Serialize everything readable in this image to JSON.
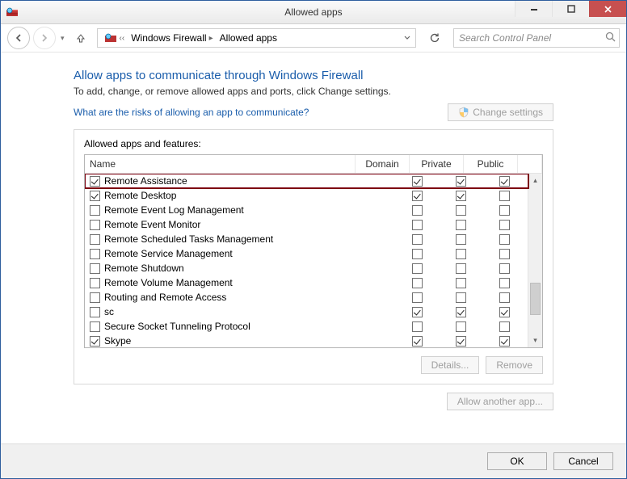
{
  "window": {
    "title": "Allowed apps"
  },
  "nav": {
    "breadcrumb": {
      "part1": "Windows Firewall",
      "part2": "Allowed apps"
    },
    "search_placeholder": "Search Control Panel"
  },
  "page": {
    "heading": "Allow apps to communicate through Windows Firewall",
    "subheading": "To add, change, or remove allowed apps and ports, click Change settings.",
    "risk_link": "What are the risks of allowing an app to communicate?",
    "change_settings": "Change settings",
    "group_label": "Allowed apps and features:",
    "columns": {
      "name": "Name",
      "domain": "Domain",
      "private": "Private",
      "public": "Public"
    },
    "details": "Details...",
    "remove": "Remove",
    "allow_another": "Allow another app..."
  },
  "rows": [
    {
      "name": "Remote Assistance",
      "enabled": true,
      "domain": true,
      "private": true,
      "public": true,
      "highlight": true
    },
    {
      "name": "Remote Desktop",
      "enabled": true,
      "domain": true,
      "private": true,
      "public": false
    },
    {
      "name": "Remote Event Log Management",
      "enabled": false,
      "domain": false,
      "private": false,
      "public": false
    },
    {
      "name": "Remote Event Monitor",
      "enabled": false,
      "domain": false,
      "private": false,
      "public": false
    },
    {
      "name": "Remote Scheduled Tasks Management",
      "enabled": false,
      "domain": false,
      "private": false,
      "public": false
    },
    {
      "name": "Remote Service Management",
      "enabled": false,
      "domain": false,
      "private": false,
      "public": false
    },
    {
      "name": "Remote Shutdown",
      "enabled": false,
      "domain": false,
      "private": false,
      "public": false
    },
    {
      "name": "Remote Volume Management",
      "enabled": false,
      "domain": false,
      "private": false,
      "public": false
    },
    {
      "name": "Routing and Remote Access",
      "enabled": false,
      "domain": false,
      "private": false,
      "public": false
    },
    {
      "name": "sc",
      "enabled": false,
      "domain": true,
      "private": true,
      "public": true
    },
    {
      "name": "Secure Socket Tunneling Protocol",
      "enabled": false,
      "domain": false,
      "private": false,
      "public": false
    },
    {
      "name": "Skype",
      "enabled": true,
      "domain": true,
      "private": true,
      "public": true
    }
  ],
  "footer": {
    "ok": "OK",
    "cancel": "Cancel"
  }
}
